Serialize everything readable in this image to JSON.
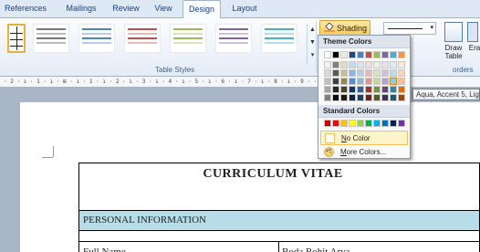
{
  "ribbon": {
    "tabs": [
      "References",
      "Mailings",
      "Review",
      "View",
      "Design",
      "Layout"
    ],
    "active_tab": "Design",
    "table_styles_label": "Table Styles",
    "borders_label": "orders",
    "shading_label": "Shading",
    "draw_table_label_1": "Draw",
    "draw_table_label_2": "Table",
    "erase_label": "Era"
  },
  "ruler": {
    "text": "· 2 · ı · 1 · ı · ⊞ · ı · 1 · ı · 2 · ı · 3 · ı · 4 · ı · 5 · ı · 6 · ı · 7 · ı · 8 · ı · 9 · ·              · · 15 · ı · ⊞"
  },
  "shading_menu": {
    "theme_colors_label": "Theme Colors",
    "standard_colors_label": "Standard Colors",
    "no_color_label": "No Color",
    "no_color_underline": "N",
    "no_color_rest": "o Color",
    "more_colors_underline": "M",
    "more_colors_rest": "ore Colors...",
    "theme_top_row": [
      "#ffffff",
      "#000000",
      "#eeece1",
      "#1f497d",
      "#4f81bd",
      "#c0504d",
      "#9bbb59",
      "#8064a2",
      "#4bacc6",
      "#f79646"
    ],
    "theme_shades": [
      [
        "#f2f2f2",
        "#7f7f7f",
        "#ddd9c3",
        "#c6d9f0",
        "#dbe5f1",
        "#f2dcdb",
        "#ebf1dd",
        "#e5e0ec",
        "#dbeef3",
        "#fdeada"
      ],
      [
        "#d8d8d8",
        "#595959",
        "#c4bd97",
        "#8db3e2",
        "#b8cce4",
        "#e5b9b7",
        "#d7e3bc",
        "#ccc1d9",
        "#b7dde8",
        "#fbd5b5"
      ],
      [
        "#bfbfbf",
        "#3f3f3f",
        "#938953",
        "#548dd4",
        "#95b3d7",
        "#d99694",
        "#c3d69b",
        "#b2a2c7",
        "#92cddc",
        "#fac08f"
      ],
      [
        "#a5a5a5",
        "#262626",
        "#494429",
        "#17365d",
        "#366092",
        "#953734",
        "#76923c",
        "#5f497a",
        "#31859b",
        "#e36c09"
      ],
      [
        "#7f7f7f",
        "#0c0c0c",
        "#1d1b10",
        "#0f243e",
        "#244061",
        "#632423",
        "#4f6128",
        "#3f3151",
        "#205867",
        "#974806"
      ]
    ],
    "standard_colors": [
      "#c00000",
      "#ff0000",
      "#ffc000",
      "#ffff00",
      "#92d050",
      "#00b050",
      "#00b0f0",
      "#0070c0",
      "#002060",
      "#7030a0"
    ],
    "tooltip": "Aqua, Accent 5, Lighter 40%"
  },
  "document": {
    "title": "CURRICULUM  VITAE",
    "section_heading": "PERSONAL INFORMATION",
    "row_label": "Full Name",
    "row_value": "Boda Rohit Arya"
  },
  "colors": {
    "highlight": "#b7dde8",
    "accent_orange": "#f8cb5a"
  }
}
